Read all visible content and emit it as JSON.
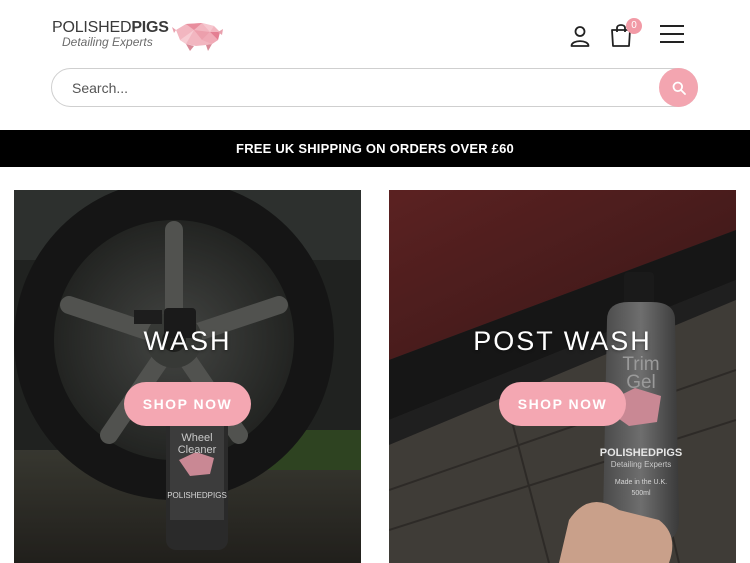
{
  "header": {
    "logo": {
      "brand_thin": "POLISHED",
      "brand_bold": "PIGS",
      "tagline": "Detailing Experts"
    },
    "cart_count": "0",
    "icons": {
      "account": "account-icon",
      "cart": "cart-icon",
      "menu": "hamburger-menu-icon",
      "search": "search-icon"
    }
  },
  "search": {
    "placeholder": "Search..."
  },
  "promo_bar": {
    "text": "FREE UK SHIPPING ON ORDERS OVER £60"
  },
  "tiles": [
    {
      "title": "WASH",
      "button_label": "SHOP NOW",
      "product_label_line1": "Wheel",
      "product_label_line2": "Cleaner",
      "product_brand": "POLISHEDPIGS"
    },
    {
      "title": "POST WASH",
      "button_label": "SHOP NOW",
      "product_label_line1": "Trim",
      "product_label_line2": "Gel",
      "product_brand": "POLISHEDPIGS",
      "product_tagline": "Detailing Experts",
      "product_origin": "Made in the U.K.",
      "product_volume": "500ml"
    }
  ],
  "colors": {
    "accent_pink": "#f4a7b2",
    "promo_bg": "#000000",
    "text_dark": "#3a3a3a"
  }
}
